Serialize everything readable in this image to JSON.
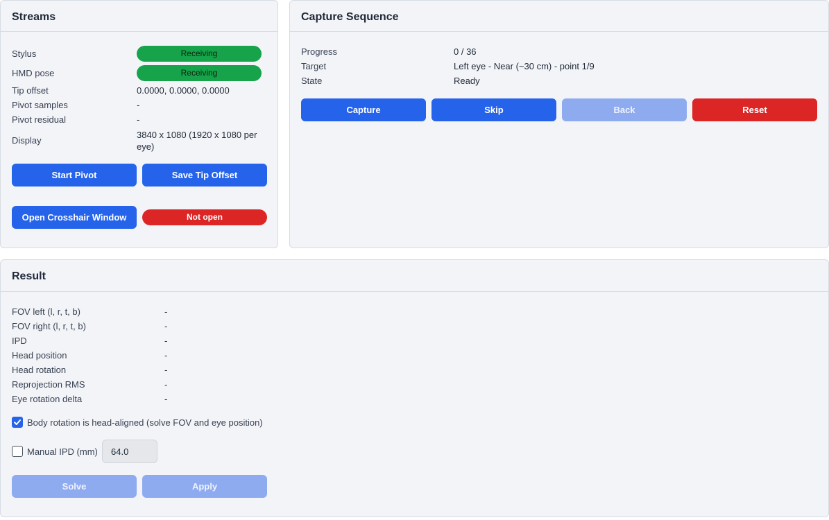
{
  "streams": {
    "title": "Streams",
    "stylus_label": "Stylus",
    "stylus_status": "Receiving",
    "hmd_label": "HMD pose",
    "hmd_status": "Receiving",
    "tip_offset_label": "Tip offset",
    "tip_offset_value": "0.0000, 0.0000, 0.0000",
    "pivot_samples_label": "Pivot samples",
    "pivot_samples_value": "-",
    "pivot_residual_label": "Pivot residual",
    "pivot_residual_value": "-",
    "display_label": "Display",
    "display_value": "3840 x 1080 (1920 x 1080 per eye)",
    "start_pivot_label": "Start Pivot",
    "save_tip_offset_label": "Save Tip Offset",
    "open_crosshair_label": "Open Crosshair Window",
    "crosshair_status": "Not open"
  },
  "capture": {
    "title": "Capture Sequence",
    "progress_label": "Progress",
    "progress_value": "0 / 36",
    "target_label": "Target",
    "target_value": "Left eye - Near (~30 cm) - point 1/9",
    "state_label": "State",
    "state_value": "Ready",
    "capture_label": "Capture",
    "skip_label": "Skip",
    "back_label": "Back",
    "reset_label": "Reset"
  },
  "result": {
    "title": "Result",
    "fov_left_label": "FOV left (l, r, t, b)",
    "fov_left_value": "-",
    "fov_right_label": "FOV right (l, r, t, b)",
    "fov_right_value": "-",
    "ipd_label": "IPD",
    "ipd_value": "-",
    "head_position_label": "Head position",
    "head_position_value": "-",
    "head_rotation_label": "Head rotation",
    "head_rotation_value": "-",
    "reprojection_label": "Reprojection RMS",
    "reprojection_value": "-",
    "eye_rotation_label": "Eye rotation delta",
    "eye_rotation_value": "-",
    "body_rotation_label": "Body rotation is head-aligned (solve FOV and eye position)",
    "body_rotation_checked": true,
    "manual_ipd_label": "Manual IPD (mm)",
    "manual_ipd_checked": false,
    "manual_ipd_value": "64.0",
    "solve_label": "Solve",
    "apply_label": "Apply"
  },
  "colors": {
    "primary": "#2563eb",
    "primary_disabled": "#8fabef",
    "success": "#16a34a",
    "danger": "#dc2626",
    "panel_bg": "#f3f4f8"
  }
}
